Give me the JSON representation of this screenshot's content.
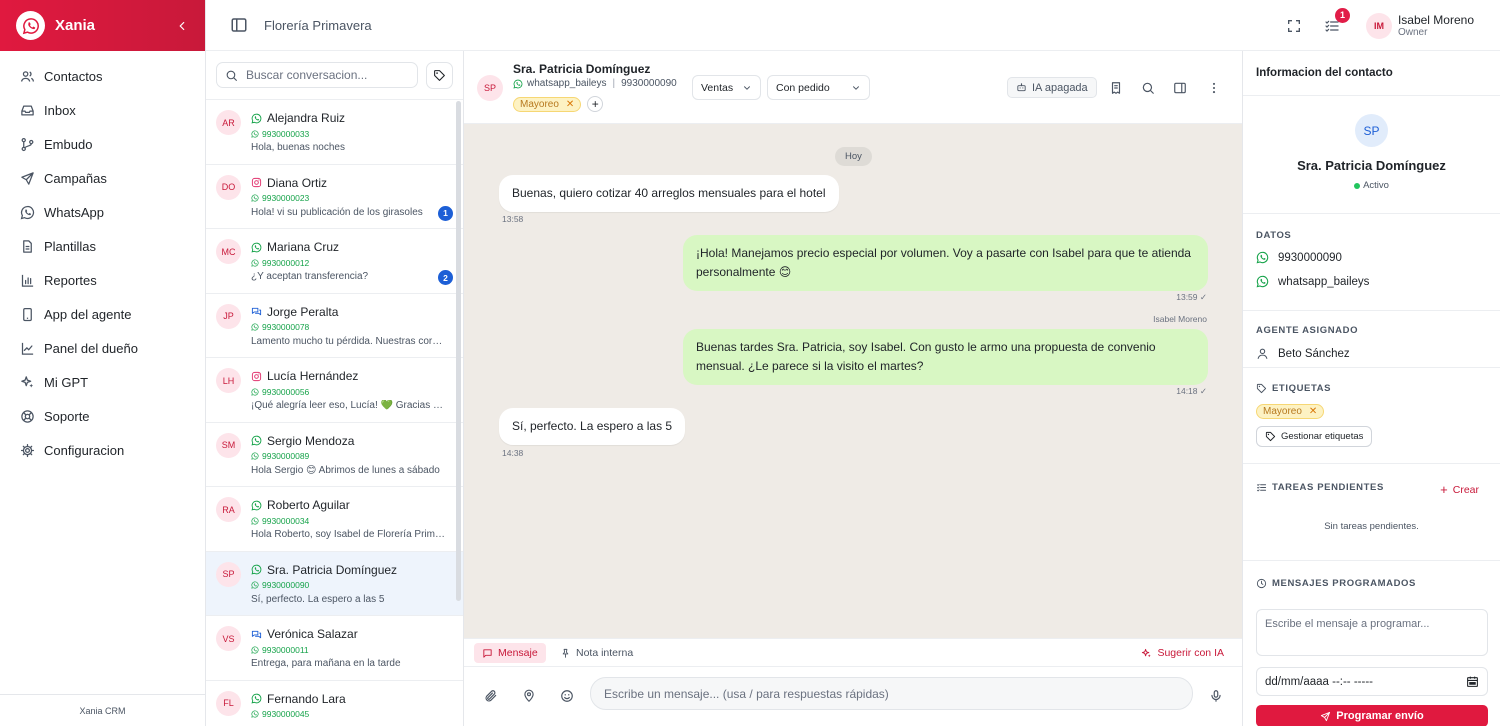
{
  "brand": {
    "name": "Xania"
  },
  "nav": [
    {
      "label": "Contactos",
      "icon": "users-icon"
    },
    {
      "label": "Inbox",
      "icon": "inbox-icon"
    },
    {
      "label": "Embudo",
      "icon": "funnel-icon"
    },
    {
      "label": "Campañas",
      "icon": "send-icon"
    },
    {
      "label": "WhatsApp",
      "icon": "whatsapp-icon"
    },
    {
      "label": "Plantillas",
      "icon": "file-icon"
    },
    {
      "label": "Reportes",
      "icon": "bar-chart-icon"
    },
    {
      "label": "App del agente",
      "icon": "phone-icon"
    },
    {
      "label": "Panel del dueño",
      "icon": "line-chart-icon"
    },
    {
      "label": "Mi GPT",
      "icon": "sparkle-icon"
    },
    {
      "label": "Soporte",
      "icon": "lifebuoy-icon"
    },
    {
      "label": "Configuracion",
      "icon": "gear-icon"
    }
  ],
  "sidebar_footer": "Xania CRM",
  "topbar": {
    "shop": "Florería Primavera",
    "notif_count": "1",
    "user_initials": "IM",
    "user_name": "Isabel Moreno",
    "user_role": "Owner"
  },
  "search": {
    "placeholder": "Buscar conversacion..."
  },
  "conversations": [
    {
      "initials": "AR",
      "name": "Alejandra Ruiz",
      "channel": "whatsapp",
      "phone": "9930000033",
      "preview": "Hola, buenas noches",
      "unread": ""
    },
    {
      "initials": "DO",
      "name": "Diana Ortiz",
      "channel": "instagram",
      "phone": "9930000023",
      "preview": "Hola! vi su publicación de los girasoles",
      "unread": "1"
    },
    {
      "initials": "MC",
      "name": "Mariana Cruz",
      "channel": "whatsapp",
      "phone": "9930000012",
      "preview": "¿Y aceptan transferencia?",
      "unread": "2"
    },
    {
      "initials": "JP",
      "name": "Jorge Peralta",
      "channel": "chat",
      "phone": "9930000078",
      "preview": "Lamento mucho tu pérdida. Nuestras coronas",
      "unread": ""
    },
    {
      "initials": "LH",
      "name": "Lucía Hernández",
      "channel": "instagram",
      "phone": "9930000056",
      "preview": "¡Qué alegría leer eso, Lucía! 💚 Gracias por",
      "unread": ""
    },
    {
      "initials": "SM",
      "name": "Sergio Mendoza",
      "channel": "whatsapp",
      "phone": "9930000089",
      "preview": "Hola Sergio 😊 Abrimos de lunes a sábado",
      "unread": ""
    },
    {
      "initials": "RA",
      "name": "Roberto Aguilar",
      "channel": "whatsapp",
      "phone": "9930000034",
      "preview": "Hola Roberto, soy Isabel de Florería Primavera",
      "unread": ""
    },
    {
      "initials": "SP",
      "name": "Sra. Patricia Domínguez",
      "channel": "whatsapp",
      "phone": "9930000090",
      "preview": "Sí, perfecto. La espero a las 5",
      "unread": "",
      "active": true
    },
    {
      "initials": "VS",
      "name": "Verónica Salazar",
      "channel": "chat",
      "phone": "9930000011",
      "preview": "Entrega, para mañana en la tarde",
      "unread": ""
    },
    {
      "initials": "FL",
      "name": "Fernando Lara",
      "channel": "whatsapp",
      "phone": "9930000045",
      "preview": "",
      "unread": ""
    }
  ],
  "chat": {
    "initials": "SP",
    "name": "Sra. Patricia Domínguez",
    "account": "whatsapp_baileys",
    "phone": "9930000090",
    "tag": "Mayoreo",
    "pipeline": "Ventas",
    "stage": "Con pedido",
    "ia_status": "IA apagada",
    "day": "Hoy",
    "messages": [
      {
        "dir": "in",
        "text": "Buenas, quiero cotizar 40 arreglos mensuales para el hotel",
        "time": "13:58"
      },
      {
        "dir": "out",
        "text": "¡Hola! Manejamos precio especial por volumen. Voy a pasarte con Isabel para que te atienda personalmente 😊",
        "time": "13:59 ✓"
      },
      {
        "dir": "out",
        "sender": "Isabel Moreno",
        "text": "Buenas tardes Sra. Patricia, soy Isabel. Con gusto le armo una propuesta de convenio mensual. ¿Le parece si la visito el martes?",
        "time": "14:18 ✓"
      },
      {
        "dir": "in",
        "text": "Sí, perfecto. La espero a las 5",
        "time": "14:38"
      }
    ],
    "tab_message": "Mensaje",
    "tab_note": "Nota interna",
    "suggest": "Sugerir con IA",
    "input_placeholder": "Escribe un mensaje... (usa / para respuestas rápidas)"
  },
  "panel": {
    "title": "Informacion del contacto",
    "initials": "SP",
    "name": "Sra. Patricia Domínguez",
    "status": "Activo",
    "datos_label": "DATOS",
    "phone": "9930000090",
    "account": "whatsapp_baileys",
    "agent_label": "AGENTE ASIGNADO",
    "agent": "Beto Sánchez",
    "tags_label": "ETIQUETAS",
    "tag": "Mayoreo",
    "manage_tags": "Gestionar etiquetas",
    "tasks_label": "TAREAS PENDIENTES",
    "create": "Crear",
    "no_tasks": "Sin tareas pendientes.",
    "scheduled_label": "MENSAJES PROGRAMADOS",
    "scheduled_placeholder": "Escribe el mensaje a programar...",
    "date_placeholder": "dd/mm/aaaa --:-- -----",
    "schedule_button": "Programar envío"
  },
  "colors": {
    "brand": "#e0193f",
    "whatsapp": "#16a34a",
    "out_bubble": "#d8f7c3",
    "chat_bg": "#efebe6"
  }
}
